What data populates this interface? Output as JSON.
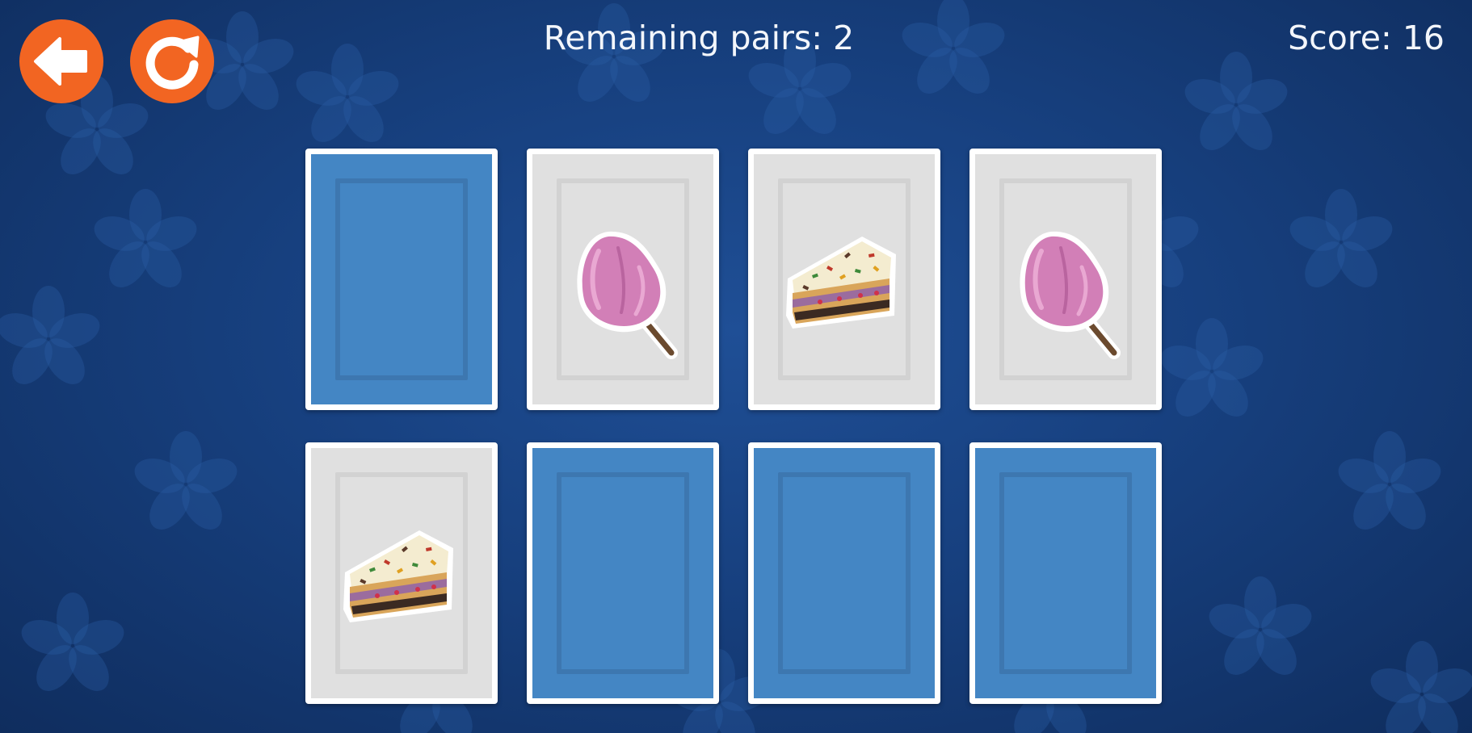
{
  "hud": {
    "remaining_pairs_text": "Remaining pairs: 2",
    "score_text": "Score: 16",
    "back_icon": "arrow-left-icon",
    "restart_icon": "restart-icon",
    "button_color": "#f26522"
  },
  "board": {
    "rows": 2,
    "columns": 4,
    "cards": [
      {
        "state": "face-down"
      },
      {
        "state": "face-up",
        "item": "cotton-candy"
      },
      {
        "state": "face-up",
        "item": "cake-slice"
      },
      {
        "state": "face-up",
        "item": "cotton-candy"
      },
      {
        "state": "face-up",
        "item": "cake-slice"
      },
      {
        "state": "face-down"
      },
      {
        "state": "face-down"
      },
      {
        "state": "face-down"
      }
    ]
  },
  "colors": {
    "background": "#17407f",
    "card_back": "#4486c4",
    "card_face": "#e0e0e0"
  }
}
